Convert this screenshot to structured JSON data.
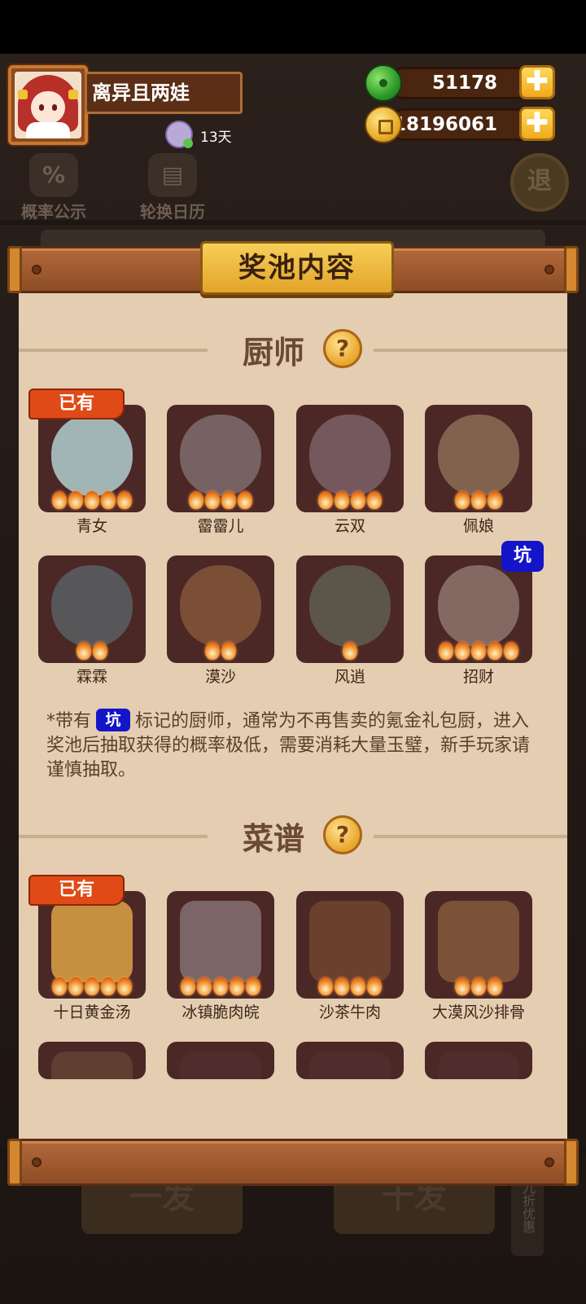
{
  "profile": {
    "name": "离异且两娃",
    "days": "13天"
  },
  "currency": {
    "jade": "51178",
    "coins": "18196061",
    "plus": "✚"
  },
  "background": {
    "probability_label": "概率公示",
    "probability_icon": "%",
    "calendar_label": "轮换日历",
    "exit_label": "退",
    "draw_one": "一发",
    "draw_ten": "十发",
    "discount": "九折优惠"
  },
  "panel": {
    "title": "奖池内容",
    "chef_section": "厨师",
    "recipe_section": "菜谱",
    "help": "?",
    "owned_label": "已有",
    "pit_label": "坑",
    "note_prefix": "*带有",
    "note_suffix": "标记的厨师，通常为不再售卖的氪金礼包厨，进入奖池后抽取获得的概率极低，需要消耗大量玉璧，新手玩家请谨慎抽取。"
  },
  "chefs": [
    {
      "name": "青女",
      "stars": 5,
      "owned": true,
      "pit": false,
      "color": "#bfe6e6"
    },
    {
      "name": "霤霤儿",
      "stars": 4,
      "owned": false,
      "pit": false,
      "color": "#c9cfd8"
    },
    {
      "name": "云双",
      "stars": 4,
      "owned": false,
      "pit": false,
      "color": "#c7b3c8"
    },
    {
      "name": "佩娘",
      "stars": 3,
      "owned": false,
      "pit": false,
      "color": "#e8d29a"
    },
    {
      "name": "霖霖",
      "stars": 2,
      "owned": false,
      "pit": false,
      "color": "#6fb3bd"
    },
    {
      "name": "漠沙",
      "stars": 2,
      "owned": false,
      "pit": false,
      "color": "#d39a56"
    },
    {
      "name": "风逍",
      "stars": 1,
      "owned": false,
      "pit": false,
      "color": "#7fae8e"
    },
    {
      "name": "招财",
      "stars": 5,
      "owned": false,
      "pit": true,
      "color": "#f2e4d6"
    }
  ],
  "recipes": [
    {
      "name": "十日黄金汤",
      "stars": 5,
      "owned": true,
      "color": "#f0b44a"
    },
    {
      "name": "冰镇脆肉皖",
      "stars": 5,
      "owned": false,
      "color": "#d9dbe0"
    },
    {
      "name": "沙茶牛肉",
      "stars": 4,
      "owned": false,
      "color": "#a8703a"
    },
    {
      "name": "大漠风沙排骨",
      "stars": 3,
      "owned": false,
      "color": "#d8a05a"
    }
  ],
  "recipes_row2": [
    {
      "color": "#8a6a4a"
    },
    {
      "color": "#5a3a3a"
    },
    {
      "color": "#5a3a3a"
    },
    {
      "color": "#5a3a3a"
    }
  ]
}
